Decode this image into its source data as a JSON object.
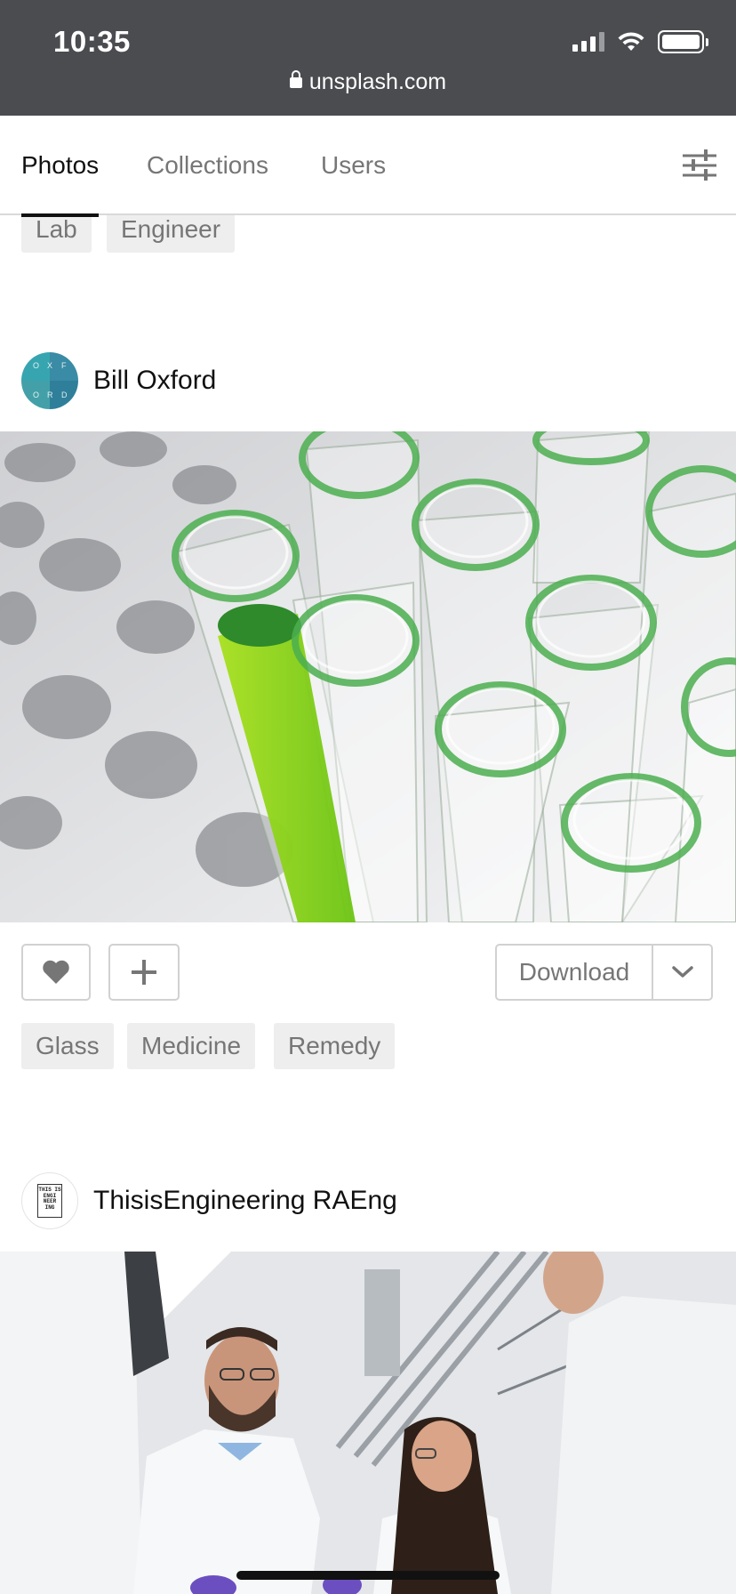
{
  "status_bar": {
    "time": "10:35",
    "url": "unsplash.com"
  },
  "tabs": [
    {
      "label": "Photos",
      "active": true
    },
    {
      "label": "Collections",
      "active": false
    },
    {
      "label": "Users",
      "active": false
    }
  ],
  "icons": {
    "filter": "sliders-icon",
    "like": "heart-icon",
    "add": "plus-icon",
    "download_menu": "chevron-down-icon"
  },
  "previous_tags": [
    "Lab",
    "Engineer"
  ],
  "posts": [
    {
      "author": "Bill Oxford",
      "avatar_letters": [
        "O",
        "X",
        "F",
        "O",
        "R",
        "D"
      ],
      "download_label": "Download",
      "tags": [
        "Glass",
        "Medicine",
        "Remedy"
      ]
    },
    {
      "author": "ThisisEngineering RAEng",
      "avatar_text": [
        "THIS IS",
        "ENGI",
        "NEER",
        "ING"
      ]
    }
  ],
  "colors": {
    "status_bg": "#4a4c50",
    "tag_bg": "#eeeeee",
    "muted_text": "#767676",
    "tube_green": "#4caf50",
    "liquid": "#8ed21e"
  }
}
